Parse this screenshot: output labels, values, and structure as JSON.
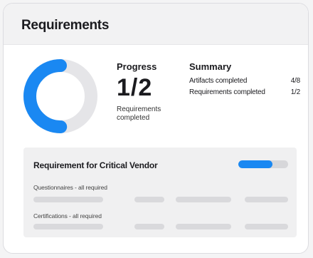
{
  "card": {
    "title": "Requirements"
  },
  "progress": {
    "label": "Progress",
    "value": "1/2",
    "subtitle_line1": "Requirements",
    "subtitle_line2": "completed",
    "fraction": 0.5
  },
  "summary": {
    "title": "Summary",
    "rows": [
      {
        "label": "Artifacts completed",
        "value": "4/8"
      },
      {
        "label": "Requirements completed",
        "value": "1/2"
      }
    ]
  },
  "requirement": {
    "title": "Requirement for Critical Vendor",
    "progress_fraction": 0.68,
    "sections": [
      {
        "label": "Questionnaires - all required"
      },
      {
        "label": "Certifications - all required"
      }
    ]
  },
  "colors": {
    "accent": "#1a88f2",
    "track": "#e5e5e8",
    "placeholder": "#d9d9dc"
  }
}
